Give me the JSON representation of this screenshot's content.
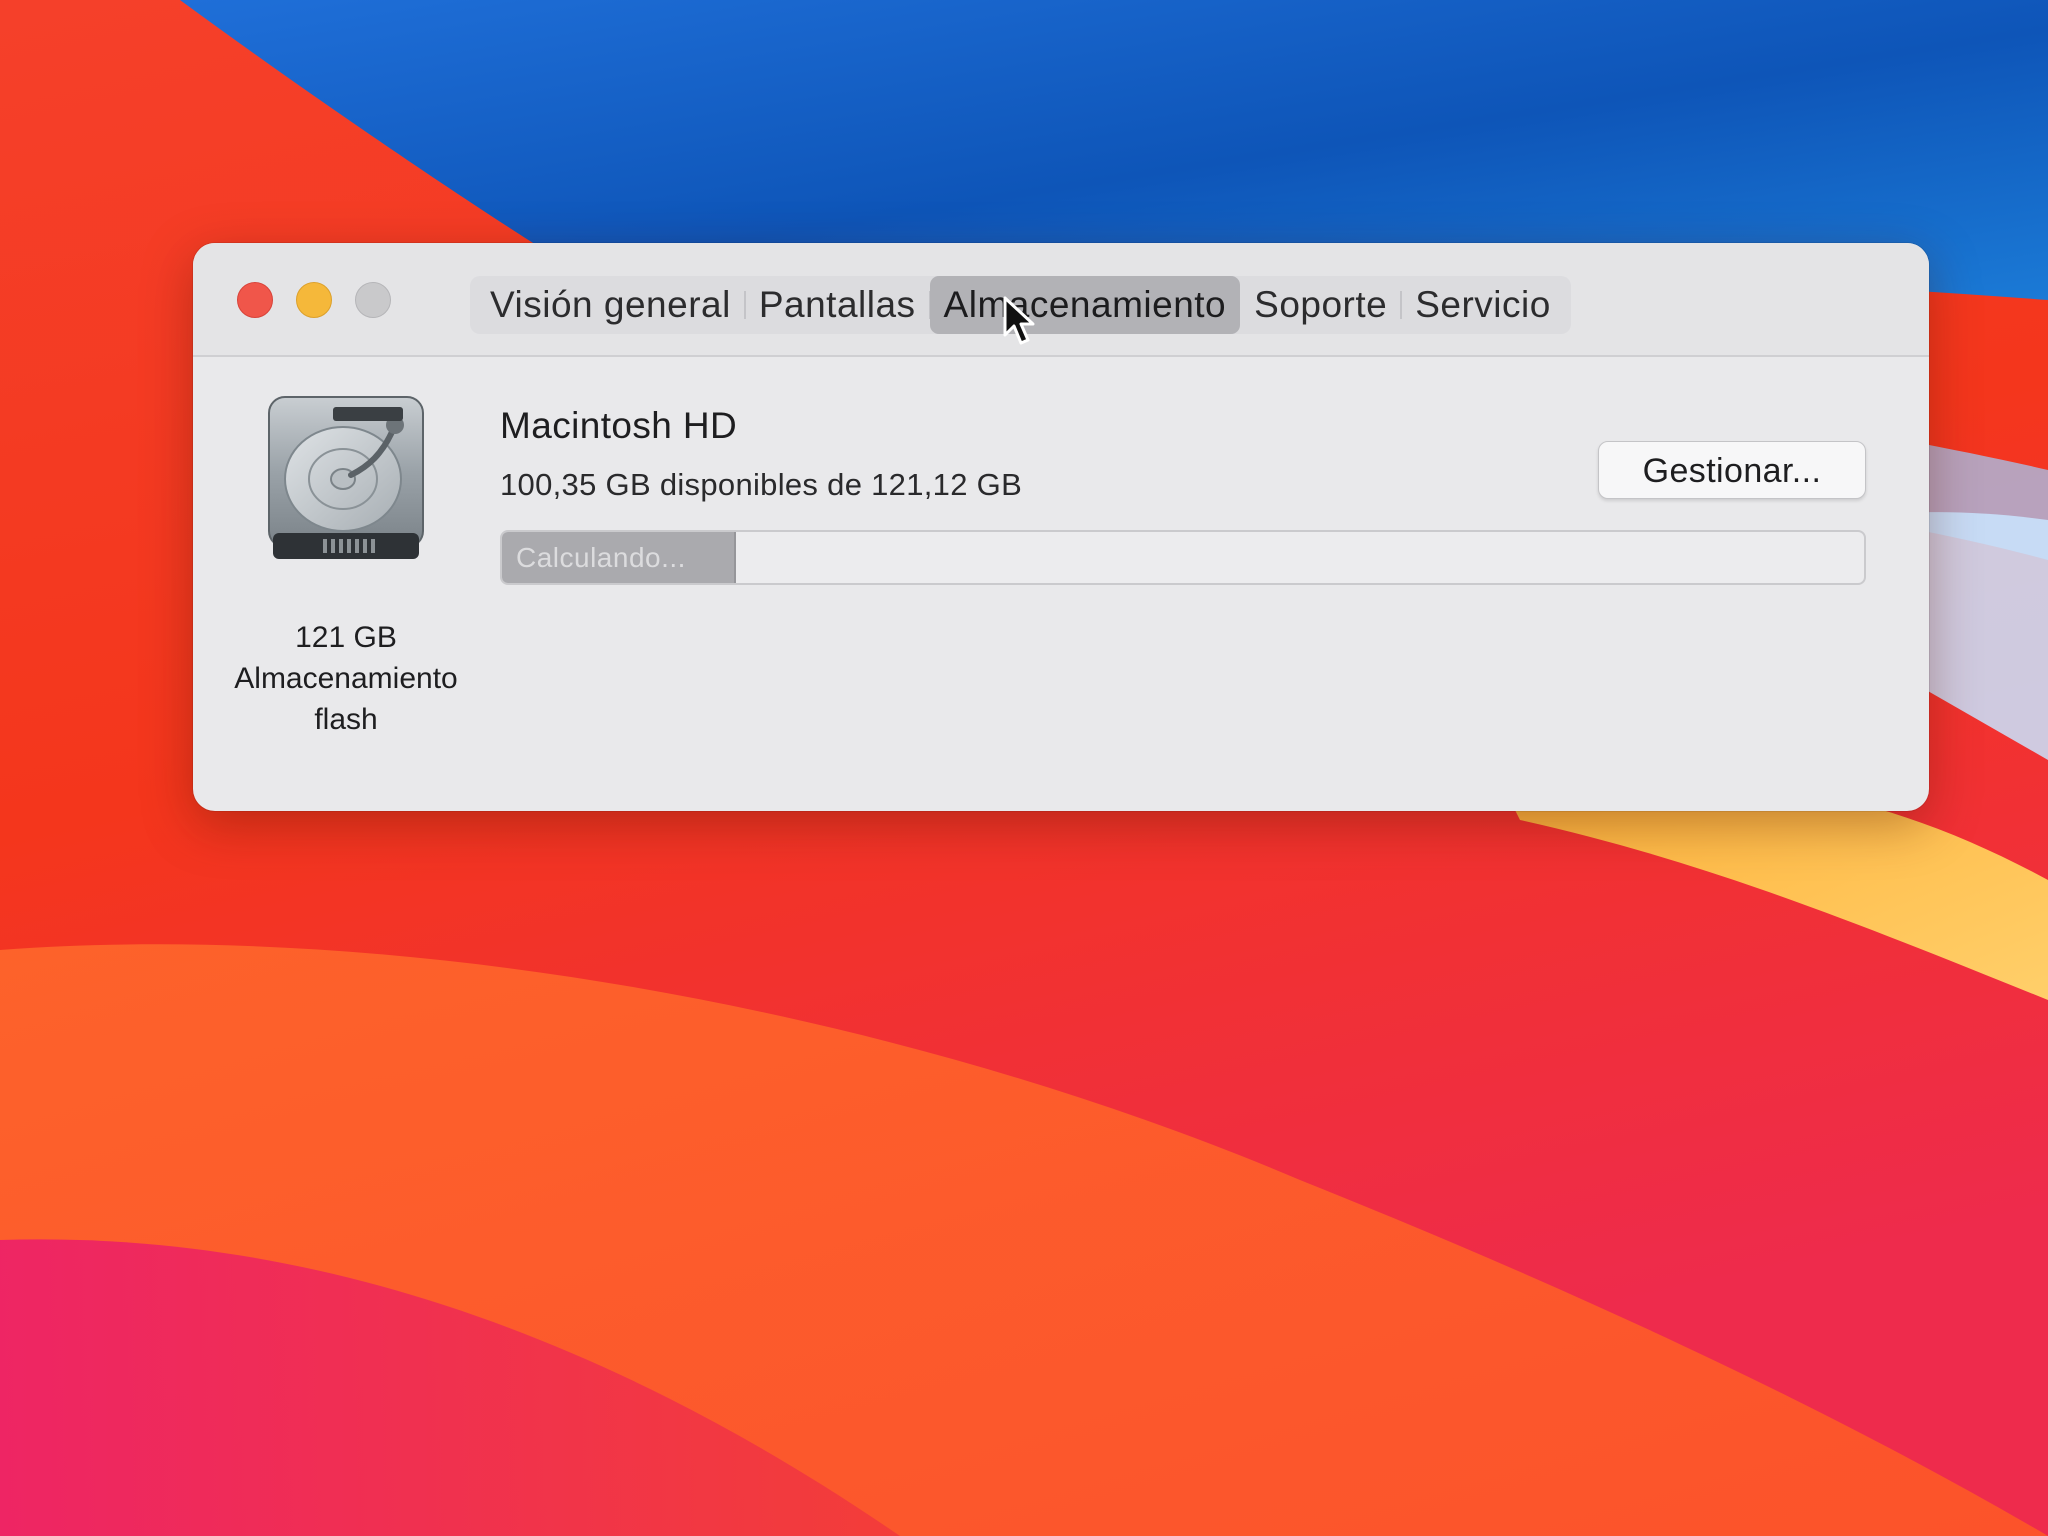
{
  "window": {
    "traffic_lights": {
      "close_color": "#f0564a",
      "minimize_color": "#f5b83a",
      "zoom_color": "#c9c9cb"
    },
    "tabs": [
      {
        "label": "Visión general",
        "active": false
      },
      {
        "label": "Pantallas",
        "active": false
      },
      {
        "label": "Almacenamiento",
        "active": true
      },
      {
        "label": "Soporte",
        "active": false
      },
      {
        "label": "Servicio",
        "active": false
      }
    ]
  },
  "storage": {
    "disk_icon": "hard-drive-icon",
    "disk_caption": {
      "capacity": "121 GB",
      "type_line1": "Almacenamiento",
      "type_line2": "flash"
    },
    "volume": {
      "name": "Macintosh HD",
      "free_text": "100,35 GB disponibles de 121,12 GB"
    },
    "manage_button_label": "Gestionar...",
    "usage_bar": {
      "label": "Calculando...",
      "fill_fraction": 0.17
    }
  },
  "colors": {
    "window_bg": "#e9e9eb",
    "active_tab": "#b2b2b6",
    "progress_fill": "#aaaaae"
  }
}
